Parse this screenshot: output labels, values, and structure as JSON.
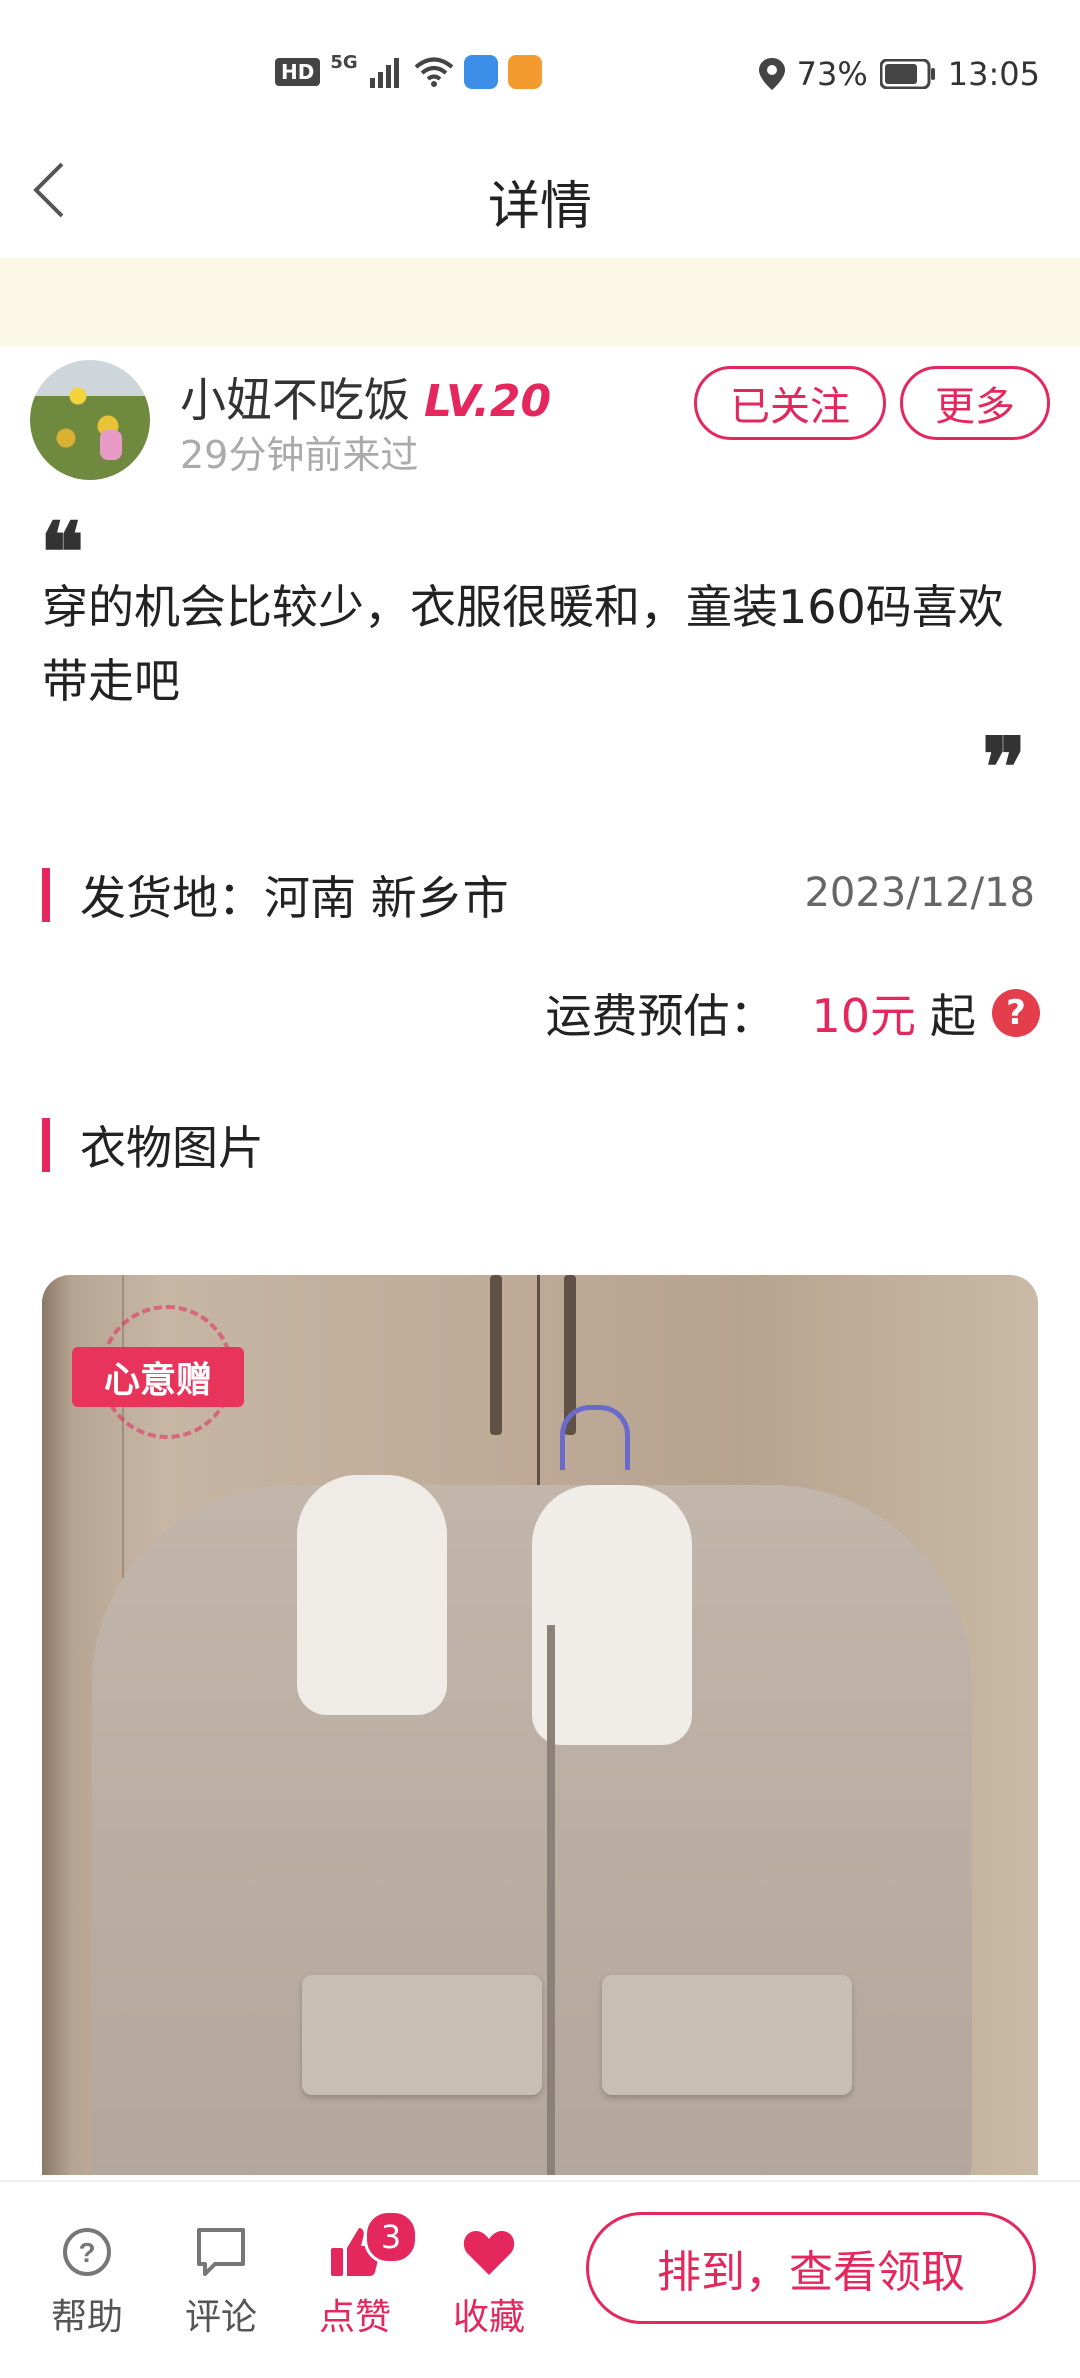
{
  "status_bar": {
    "hd": "HD",
    "network": "5G",
    "battery": "73%",
    "time": "13:05"
  },
  "nav": {
    "title": "详情"
  },
  "user": {
    "name": "小妞不吃饭",
    "level": "LV.20",
    "last_seen": "29分钟前来过",
    "follow_label": "已关注",
    "more_label": "更多"
  },
  "post": {
    "quote_open": "❝",
    "description": "穿的机会比较少，衣服很暖和，童装160码喜欢带走吧",
    "quote_close": "❞"
  },
  "shipping": {
    "from_label": "发货地：河南 新乡市",
    "date": "2023/12/18",
    "fee_label": "运费预估：",
    "fee_amount": "10元",
    "fee_suffix": "起",
    "help_glyph": "?"
  },
  "photos": {
    "section_title": "衣物图片",
    "stamp_text": "心意赠"
  },
  "tabbar": {
    "help": "帮助",
    "comment": "评论",
    "like": "点赞",
    "like_count": "3",
    "favorite": "收藏",
    "claim": "排到，查看领取"
  },
  "colors": {
    "accent": "#e4275d",
    "banner": "#fbf8e6"
  }
}
